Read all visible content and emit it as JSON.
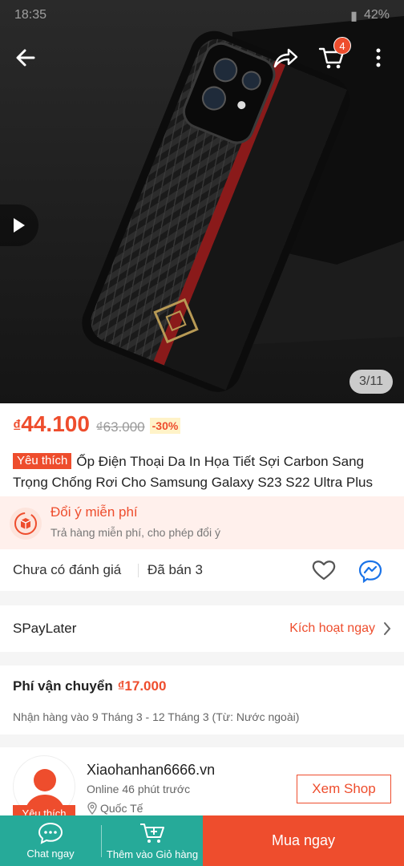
{
  "status_bar": {
    "time": "18:35",
    "battery": "42%"
  },
  "hero": {
    "image_counter": "3/11",
    "back_icon": "arrow-left-icon",
    "share_icon": "share-icon",
    "cart_icon": "cart-icon",
    "cart_badge": "4",
    "more_icon": "more-vertical-icon",
    "play_icon": "play-icon"
  },
  "product": {
    "currency": "₫",
    "price": "44.100",
    "old_price": "₫63.000",
    "discount": "-30%",
    "favorite_tag": "Yêu thích",
    "title": "Ốp Điện Thoại Da In Họa Tiết Sợi Carbon Sang Trọng Chống Rơi Cho Samsung Galaxy S23 S22 Ultra Plus"
  },
  "returns": {
    "title": "Đổi ý miễn phí",
    "subtitle": "Trả hàng miễn phí, cho phép đổi ý"
  },
  "rating": {
    "no_rating": "Chưa có đánh giá",
    "sold": "Đã bán 3"
  },
  "spaylater": {
    "label": "SPayLater",
    "action": "Kích hoạt ngay"
  },
  "shipping": {
    "label": "Phí vận chuyển",
    "price": "₫17.000",
    "delivery": "Nhận hàng vào 9 Tháng 3 - 12 Tháng 3 (Từ: Nước ngoài)"
  },
  "shop": {
    "badge": "Yêu thích",
    "name": "Xiaohanhan6666.vn",
    "online": "Online 46 phút trước",
    "location": "Quốc Tế",
    "view_button": "Xem Shop"
  },
  "bottom_bar": {
    "chat": "Chat ngay",
    "add_to_cart": "Thêm vào Giỏ hàng",
    "buy_now": "Mua ngay"
  },
  "colors": {
    "brand": "#ee4d2d",
    "teal": "#26aa99"
  }
}
